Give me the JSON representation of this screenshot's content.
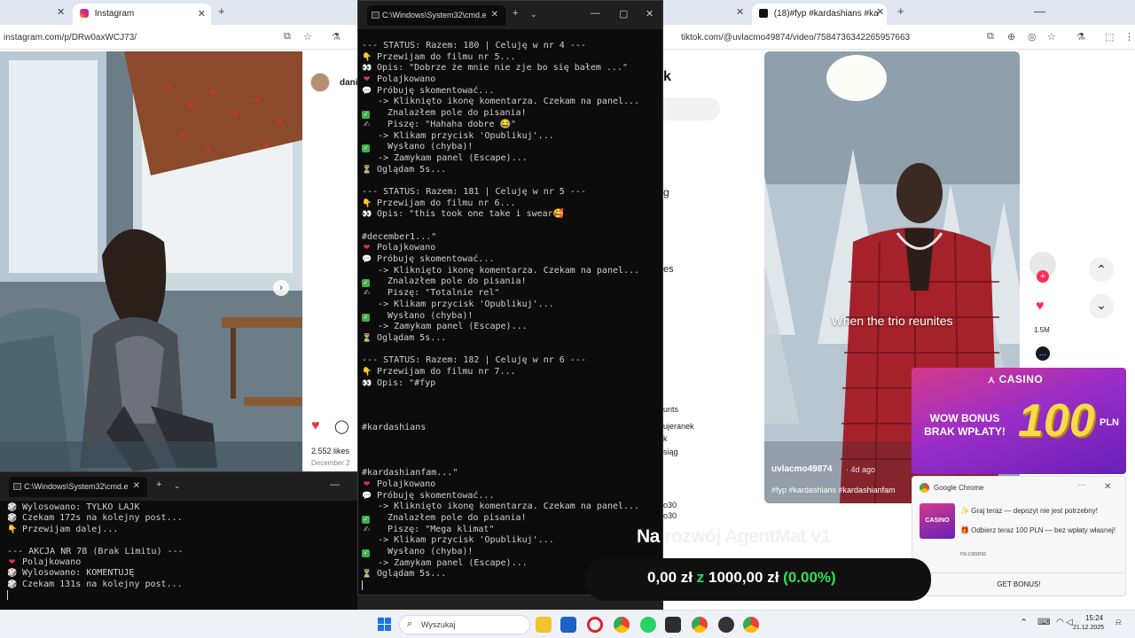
{
  "left_browser": {
    "tabs": [
      {
        "label": ""
      },
      {
        "label": "Instagram"
      }
    ],
    "url": "instagram.com/p/DRw0axWCJ73/",
    "post": {
      "username_partial": "dani",
      "likes": "2.552 likes",
      "date_partial": "December 2"
    }
  },
  "cmd_main": {
    "tab_title": "C:\\Windows\\System32\\cmd.e",
    "lines": [
      {
        "e": "",
        "t": "--- STATUS: Razem: 180 | Celuję w nr 4 ---"
      },
      {
        "e": "👇",
        "c": "e-yellow",
        "t": " Przewijam do filmu nr 5..."
      },
      {
        "e": "👀",
        "c": "e-white",
        "t": " Opis: \"Dobrze że mnie nie zje bo się bałem ...\""
      },
      {
        "e": "❤",
        "c": "e-red",
        "t": " Polajkowano"
      },
      {
        "e": "💬",
        "c": "e-white",
        "t": " Próbuję skomentować..."
      },
      {
        "e": "",
        "t": "   -> Kliknięto ikonę komentarza. Czekam na panel..."
      },
      {
        "e": "✓",
        "c": "e-green",
        "t": "   Znalazłem pole do pisania!"
      },
      {
        "e": "✍",
        "c": "e-gray",
        "t": "   Piszę: \"Hahaha dobre 😂\""
      },
      {
        "e": "",
        "t": "   -> Klikam przycisk 'Opublikuj'..."
      },
      {
        "e": "✓",
        "c": "e-green",
        "t": "   Wysłano (chyba)!"
      },
      {
        "e": "",
        "t": "   -> Zamykam panel (Escape)..."
      },
      {
        "e": "⏳",
        "c": "e-yellow",
        "t": " Oglądam 5s..."
      },
      {
        "e": "",
        "t": ""
      },
      {
        "e": "",
        "t": "--- STATUS: Razem: 181 | Celuję w nr 5 ---"
      },
      {
        "e": "👇",
        "c": "e-yellow",
        "t": " Przewijam do filmu nr 6..."
      },
      {
        "e": "👀",
        "c": "e-white",
        "t": " Opis: \"this took one take i swear🥰"
      },
      {
        "e": "",
        "t": ""
      },
      {
        "e": "",
        "t": "#december1...\""
      },
      {
        "e": "❤",
        "c": "e-red",
        "t": " Polajkowano"
      },
      {
        "e": "💬",
        "c": "e-white",
        "t": " Próbuję skomentować..."
      },
      {
        "e": "",
        "t": "   -> Kliknięto ikonę komentarza. Czekam na panel..."
      },
      {
        "e": "✓",
        "c": "e-green",
        "t": "   Znalazłem pole do pisania!"
      },
      {
        "e": "✍",
        "c": "e-gray",
        "t": "   Piszę: \"Totalnie rel\""
      },
      {
        "e": "",
        "t": "   -> Klikam przycisk 'Opublikuj'..."
      },
      {
        "e": "✓",
        "c": "e-green",
        "t": "   Wysłano (chyba)!"
      },
      {
        "e": "",
        "t": "   -> Zamykam panel (Escape)..."
      },
      {
        "e": "⏳",
        "c": "e-yellow",
        "t": " Oglądam 5s..."
      },
      {
        "e": "",
        "t": ""
      },
      {
        "e": "",
        "t": "--- STATUS: Razem: 182 | Celuję w nr 6 ---"
      },
      {
        "e": "👇",
        "c": "e-yellow",
        "t": " Przewijam do filmu nr 7..."
      },
      {
        "e": "👀",
        "c": "e-white",
        "t": " Opis: \"#fyp"
      },
      {
        "e": "",
        "t": ""
      },
      {
        "e": "",
        "t": ""
      },
      {
        "e": "",
        "t": ""
      },
      {
        "e": "",
        "t": "#kardashians"
      },
      {
        "e": "",
        "t": ""
      },
      {
        "e": "",
        "t": ""
      },
      {
        "e": "",
        "t": ""
      },
      {
        "e": "",
        "t": "#kardashianfam...\""
      },
      {
        "e": "❤",
        "c": "e-red",
        "t": " Polajkowano"
      },
      {
        "e": "💬",
        "c": "e-white",
        "t": " Próbuję skomentować..."
      },
      {
        "e": "",
        "t": "   -> Kliknięto ikonę komentarza. Czekam na panel..."
      },
      {
        "e": "✓",
        "c": "e-green",
        "t": "   Znalazłem pole do pisania!"
      },
      {
        "e": "✍",
        "c": "e-gray",
        "t": "   Piszę: \"Mega klimat\""
      },
      {
        "e": "",
        "t": "   -> Klikam przycisk 'Opublikuj'..."
      },
      {
        "e": "✓",
        "c": "e-green",
        "t": "   Wysłano (chyba)!"
      },
      {
        "e": "",
        "t": "   -> Zamykam panel (Escape)..."
      },
      {
        "e": "⏳",
        "c": "e-yellow",
        "t": " Oglądam 5s..."
      }
    ]
  },
  "cmd_small": {
    "tab_title": "C:\\Windows\\System32\\cmd.e",
    "lines": [
      {
        "e": "🎲",
        "c": "e-white",
        "t": " Wylosowano: TYLKO LAJK"
      },
      {
        "e": "🎲",
        "c": "e-white",
        "t": " Czekam 172s na kolejny post..."
      },
      {
        "e": "👇",
        "c": "e-yellow",
        "t": " Przewijam dalej..."
      },
      {
        "e": "",
        "t": ""
      },
      {
        "e": "",
        "t": "--- AKCJA NR 78 (Brak Limitu) ---"
      },
      {
        "e": "❤",
        "c": "e-red",
        "t": " Polajkowano"
      },
      {
        "e": "🎲",
        "c": "e-white",
        "t": " Wylosowano: KOMENTUJĘ"
      },
      {
        "e": "🎲",
        "c": "e-white",
        "t": " Czekam 131s na kolejny post..."
      }
    ]
  },
  "right_browser": {
    "tab_label": "(18)#fyp #kardashians #ka",
    "url": "tiktok.com/@uvlacmo49874/video/7584736342265957663",
    "partial_left_texts": [
      "k",
      "g",
      "es",
      "unts",
      "ujeranek",
      "k",
      "siąg",
      "o30",
      "o30"
    ],
    "video": {
      "caption_center": "When the trio reunites",
      "author": "uvlacmo49874",
      "age": "· 4d ago",
      "hashtags": "#fyp #kardashians #kardashianfam"
    },
    "rail": {
      "likes": "1.5M"
    }
  },
  "casino_ad": {
    "brand": "CASINO",
    "headline_line1": "WOW BONUS",
    "headline_line2": "BRAK WPŁATY!",
    "amount": "100",
    "currency": "PLN"
  },
  "chrome_notification": {
    "app": "Google Chrome",
    "line1": "✨ Graj teraz — depozyt nie jest potrzebny!",
    "line2": "🎁 Odbierz teraz 100 PLN — bez wpłaty własnej!",
    "domain": "nv.casino",
    "button": "GET BONUS!"
  },
  "overlay": {
    "progress_title": "Na rozwój AgentMat v1",
    "current": "0,00 zł",
    "separator": "z",
    "goal": "1000,00 zł",
    "percent": "(0.00%)",
    "colors": {
      "accent": "#2ee05a"
    }
  },
  "taskbar": {
    "search_placeholder": "Wyszukaj",
    "time": "15:24",
    "date": "21.12.2025"
  }
}
